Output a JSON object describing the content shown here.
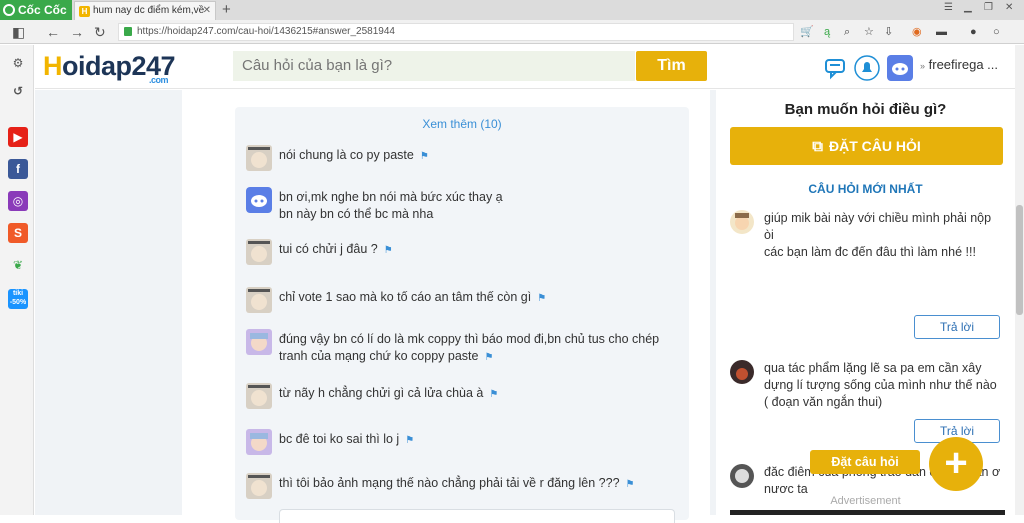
{
  "browser": {
    "brand": "Cốc Cốc",
    "tab_title": "hum nay dc điểm kém,về",
    "url": "https://hoidap247.com/cau-hoi/1436215#answer_2581944"
  },
  "header": {
    "logo_main": "oidap247",
    "logo_h": "H",
    "logo_suffix": ".com",
    "search_placeholder": "Câu hỏi của bạn là gì?",
    "search_button": "Tìm",
    "username": "freefirega ..."
  },
  "comments": {
    "see_more": "Xem thêm (10)",
    "items": [
      {
        "text": "nói chung là co py paste",
        "avatar": "meme"
      },
      {
        "text": "bn ơi,mk nghe bn nói mà bức xúc thay ạ\nbn này bn có thể bc mà nha",
        "avatar": "discord"
      },
      {
        "text": "tui có chửi j đâu ?",
        "avatar": "meme"
      },
      {
        "text": "chỉ vote 1 sao mà ko tố cáo an tâm thế còn gì",
        "avatar": "meme"
      },
      {
        "text": "đúng vậy bn có lí do là mk coppy thì báo mod đi,bn chủ tus cho chép tranh của mạng chứ ko coppy paste",
        "avatar": "anime"
      },
      {
        "text": "từ nãy h chẳng chửi gì cả lửa  chùa à",
        "avatar": "meme"
      },
      {
        "text": "bc đê toi ko sai thì lo j",
        "avatar": "anime"
      },
      {
        "text": "thì tôi bảo ảnh mạng thế nào chẳng phải tải về r đăng lên ???",
        "avatar": "meme"
      }
    ]
  },
  "sidebar_right": {
    "ask_title": "Bạn muốn hỏi điều gì?",
    "ask_button": "ĐẶT CÂU HỎI",
    "new_title": "CÂU HỎI MỚI NHẤT",
    "questions": [
      {
        "text": "giúp mik bài này với chiều mình phải nộp òi\ncác bạn làm đc đến đâu thì làm nhé !!!",
        "reply": "Trả lời"
      },
      {
        "text": "qua tác phẩm lặng lẽ sa pa em cần xây dựng lí tượng sống của mình như thế nào ( đoạn văn ngắn thui)",
        "reply": "Trả lời"
      },
      {
        "text": "đăc điêm cua phong trao dân chu tư san ơ nươc ta"
      }
    ],
    "float_label": "Đặt câu hỏi",
    "float_plus": "+",
    "advertisement": "Advertisement"
  },
  "colors": {
    "accent": "#e7b10b",
    "link": "#3a8fd6",
    "title_blue": "#1f76b8"
  }
}
